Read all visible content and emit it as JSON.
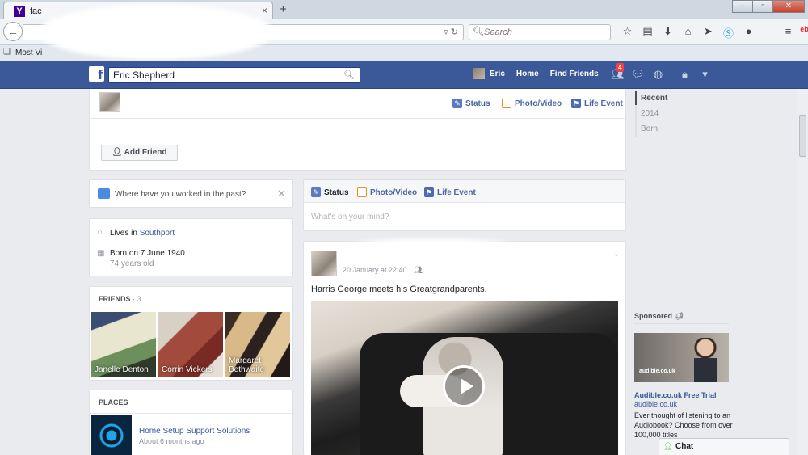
{
  "browser": {
    "tab_title": "fac",
    "tab_close": "×",
    "new_tab": "+",
    "search_placeholder": "Search",
    "bookmark_label": "Most Vi"
  },
  "fb": {
    "search_value": "Eric Shepherd",
    "nav": {
      "user": "Eric",
      "home": "Home",
      "find_friends": "Find Friends"
    },
    "notifications_count": "4"
  },
  "profile": {
    "composer": {
      "status": "Status",
      "photo_video": "Photo/Video",
      "life_event": "Life Event"
    },
    "add_friend": "Add Friend"
  },
  "work_prompt": "Where have you worked in the past?",
  "about": {
    "lives_in_label": "Lives in ",
    "lives_in_city": "Southport",
    "born": "Born on 7 June 1940",
    "age": "74 years old"
  },
  "friends": {
    "title": "FRIENDS",
    "count": "· 3",
    "items": [
      {
        "name": "Janelle Denton"
      },
      {
        "name": "Corrin Vickers"
      },
      {
        "name": "Margaret Bethwaite"
      }
    ]
  },
  "places": {
    "title": "PLACES",
    "items": [
      {
        "name": "Home Setup Support Solutions",
        "time": "About 6 months ago"
      }
    ]
  },
  "composer2": {
    "status": "Status",
    "photo_video": "Photo/Video",
    "life_event": "Life Event",
    "placeholder": "What's on your mind?"
  },
  "post": {
    "meta": "20 January at 22:40 · ",
    "text": "Harris George meets his Greatgrandparents."
  },
  "timeline": {
    "items": [
      "Recent",
      "2014",
      "Born"
    ]
  },
  "sponsored": {
    "label": "Sponsored",
    "ad_logo": "audible.co.uk",
    "title": "Audible.co.uk Free Trial",
    "domain": "audible.co.uk",
    "body": "Ever thought of listening to an Audiobook? Choose from over 100,000 titles"
  },
  "chat": {
    "label": "Chat"
  },
  "colors": {
    "fb_blue": "#3b5998",
    "link": "#365899",
    "background": "#e9ebee"
  }
}
